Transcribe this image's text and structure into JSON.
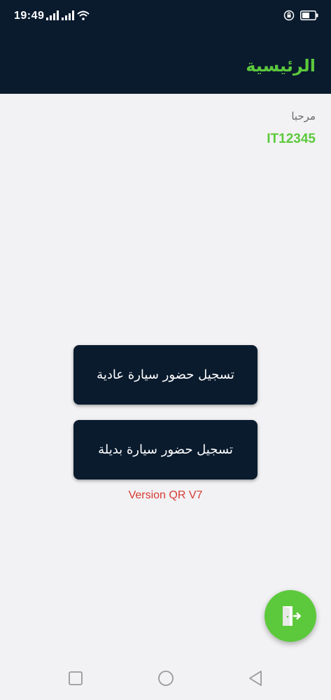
{
  "status_bar": {
    "time": "19:49"
  },
  "app_bar": {
    "title": "الرئيسية"
  },
  "main": {
    "welcome_label": "مرحبا",
    "user_code": "IT12345",
    "btn_normal_label": "تسجيل حضور سيارة عادية",
    "btn_alt_label": "تسجيل حضور سيارة بديلة",
    "version": "Version QR V7"
  },
  "fab": {
    "icon": "logout-icon"
  },
  "colors": {
    "navy": "#0a1b2e",
    "green": "#5cc93c",
    "red": "#d63a32"
  }
}
